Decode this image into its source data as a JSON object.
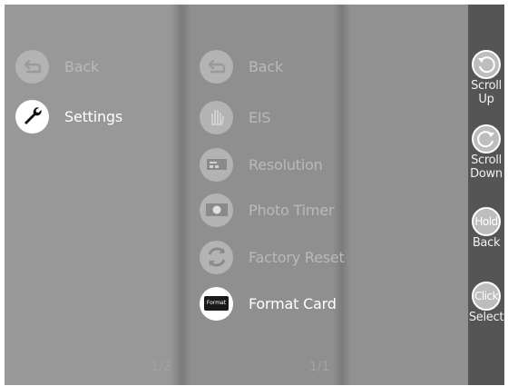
{
  "left_menu": {
    "items": [
      {
        "label": "Back",
        "icon": "back-arrow-icon",
        "active": false
      },
      {
        "label": "Settings",
        "icon": "wrench-icon",
        "active": true
      }
    ],
    "page": "1/2"
  },
  "settings_menu": {
    "items": [
      {
        "label": "Back",
        "icon": "back-arrow-icon",
        "active": false
      },
      {
        "label": "EIS",
        "icon": "hand-stabilization-icon",
        "active": false
      },
      {
        "label": "Resolution",
        "icon": "resolution-icon",
        "active": false
      },
      {
        "label": "Photo Timer",
        "icon": "photo-timer-icon",
        "active": false
      },
      {
        "label": "Factory Reset",
        "icon": "factory-reset-icon",
        "active": false
      },
      {
        "label": "Format Card",
        "icon": "format-card-icon",
        "chip_text": "Format",
        "active": true
      }
    ],
    "page": "1/1"
  },
  "controls": {
    "scroll_up": {
      "line1": "Scroll",
      "line2": "Up"
    },
    "scroll_down": {
      "line1": "Scroll",
      "line2": "Down"
    },
    "hold": {
      "button": "Hold",
      "label": "Back"
    },
    "click": {
      "button": "Click",
      "label": "Select"
    }
  },
  "colors": {
    "background": "#8e8e8e",
    "sidebar": "#555555",
    "active_text": "#ffffff",
    "dim_text": "#b9b9b9"
  }
}
